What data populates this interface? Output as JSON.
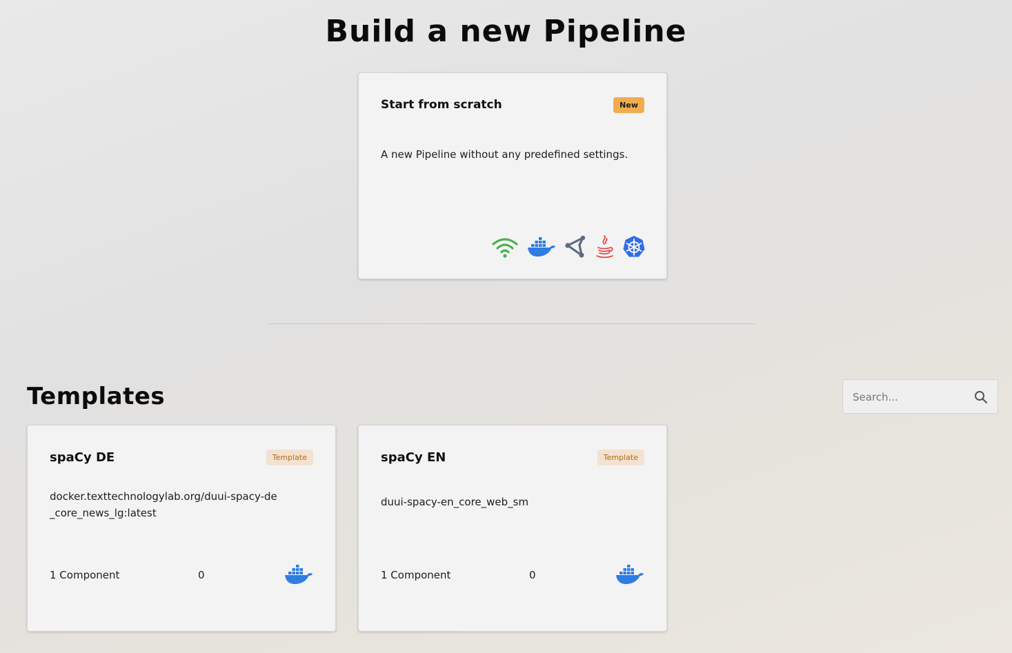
{
  "page": {
    "title": "Build a new Pipeline"
  },
  "scratch_card": {
    "title": "Start from scratch",
    "badge": "New",
    "description": "A new Pipeline without any predefined settings.",
    "icons": [
      "wifi-icon",
      "docker-icon",
      "uima-icon",
      "java-icon",
      "kubernetes-icon"
    ]
  },
  "templates_section": {
    "title": "Templates",
    "search": {
      "placeholder": "Search...",
      "value": ""
    },
    "cards": [
      {
        "title": "spaCy DE",
        "badge": "Template",
        "description": "docker.texttechnologylab.org/duui-spacy-de_core_news_lg:latest",
        "components_label": "1 Component",
        "count": "0",
        "icon": "docker-icon"
      },
      {
        "title": "spaCy EN",
        "badge": "Template",
        "description": "duui-spacy-en_core_web_sm",
        "components_label": "1 Component",
        "count": "0",
        "icon": "docker-icon"
      }
    ]
  },
  "colors": {
    "badge_new_bg": "#f0ad4e",
    "badge_template_bg": "#f3e2cf",
    "badge_template_text": "#b46a14",
    "wifi_green": "#4caf50",
    "docker_blue": "#2f7de1",
    "uima_gray": "#5d6b80",
    "java_red": "#e53935",
    "kubernetes_blue": "#326ce5"
  }
}
